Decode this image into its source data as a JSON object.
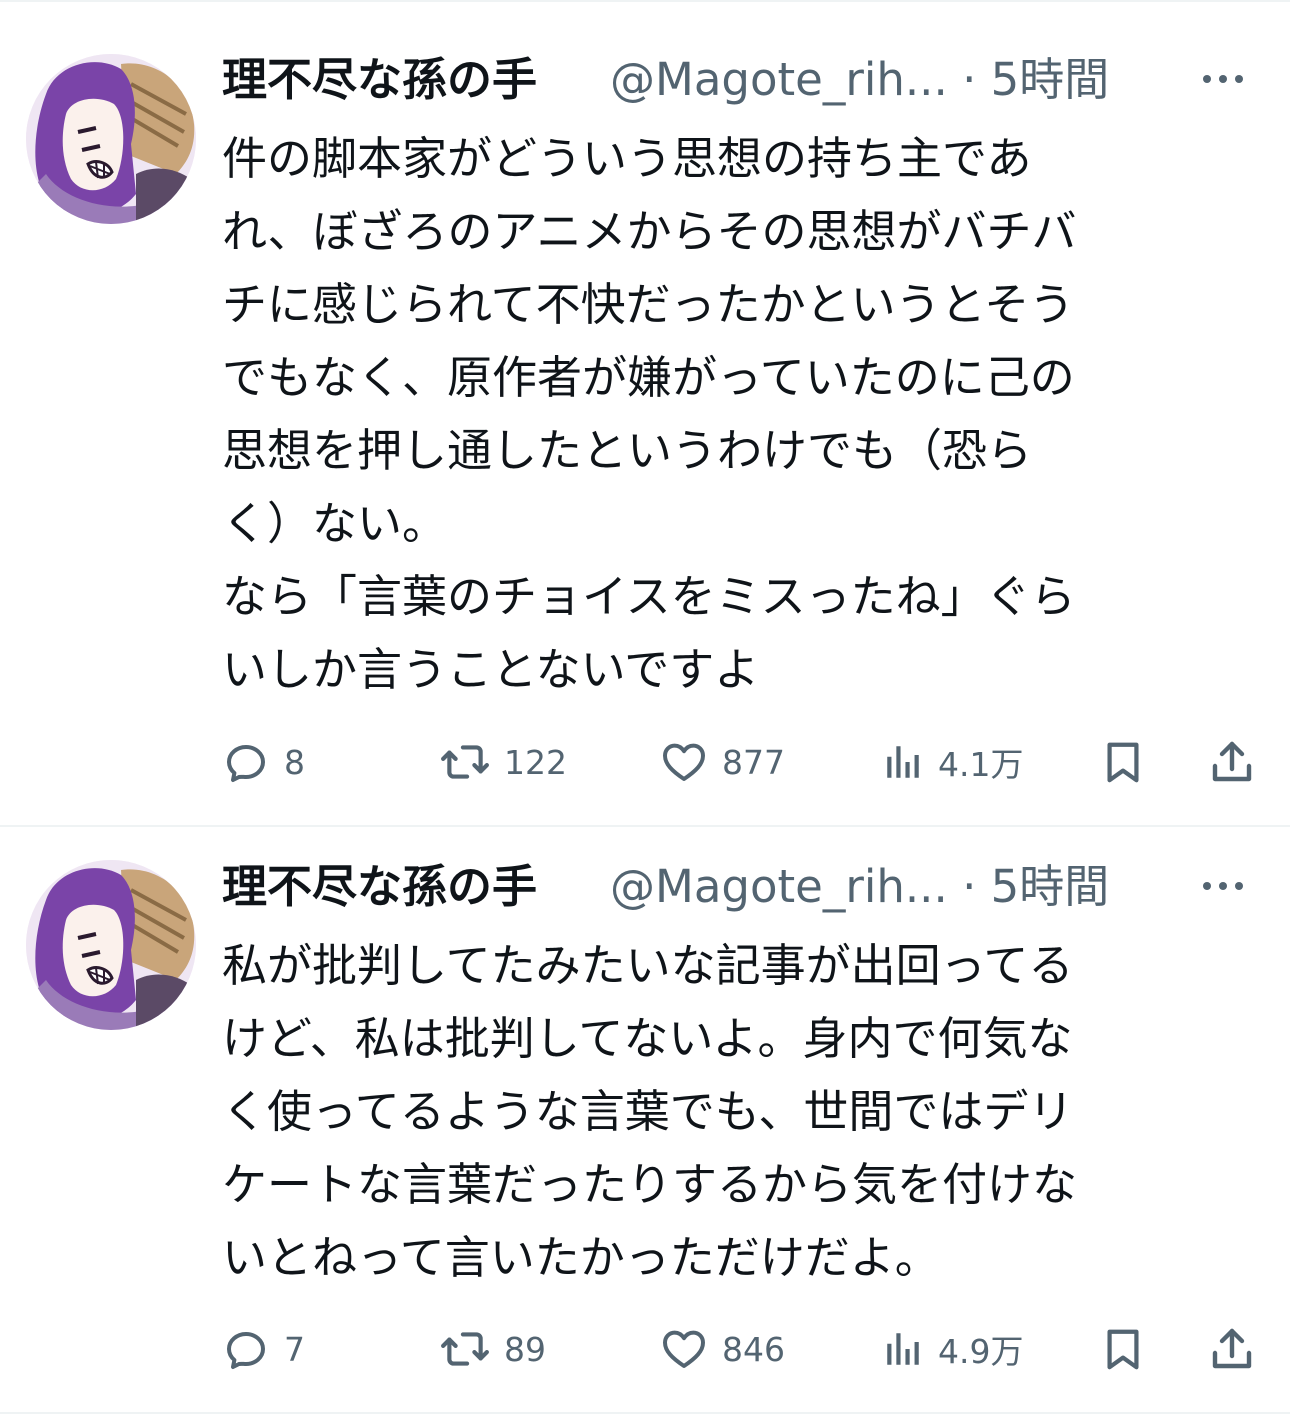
{
  "colors": {
    "text_primary": "#0f1419",
    "text_secondary": "#536471",
    "divider": "#eff3f4",
    "avatar_purple": "#7a44a8"
  },
  "tweets": [
    {
      "author": {
        "display_name": "理不尽な孫の手",
        "handle_time": "@Magote_rih... · 5時間",
        "avatar_icon": "avatar-icon"
      },
      "more_icon": "more-icon",
      "text": "件の脚本家がどういう思想の持ち主であ\nれ、ぼざろのアニメからその思想がバチバ\nチに感じられて不快だったかというとそう\nでもなく、原作者が嫌がっていたのに己の\n思想を押し通したというわけでも（恐ら\nく）ない。\nなら「言葉のチョイスをミスったね」ぐら\nいしか言うことないですよ",
      "actions": {
        "replies": "8",
        "retweets": "122",
        "likes": "877",
        "views": "4.1万"
      }
    },
    {
      "author": {
        "display_name": "理不尽な孫の手",
        "handle_time": "@Magote_rih... · 5時間",
        "avatar_icon": "avatar-icon"
      },
      "more_icon": "more-icon",
      "text": "私が批判してたみたいな記事が出回ってる\nけど、私は批判してないよ。身内で何気な\nく使ってるような言葉でも、世間ではデリ\nケートな言葉だったりするから気を付けな\nいとねって言いたかっただけだよ。",
      "actions": {
        "replies": "7",
        "retweets": "89",
        "likes": "846",
        "views": "4.9万"
      }
    }
  ]
}
